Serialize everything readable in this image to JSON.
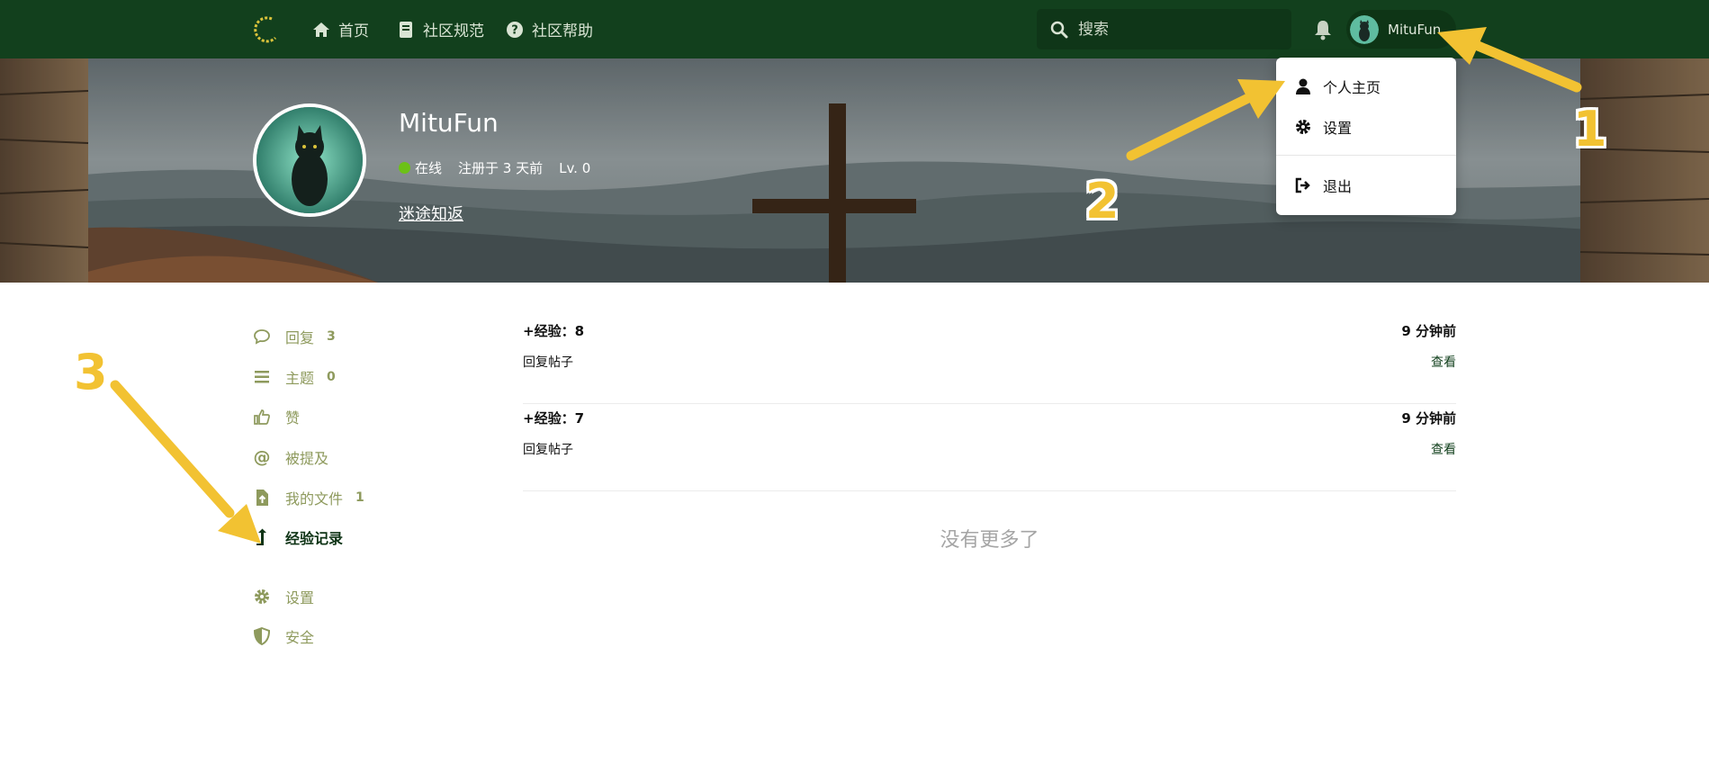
{
  "header": {
    "nav": [
      {
        "label": "首页",
        "icon": "home-icon"
      },
      {
        "label": "社区规范",
        "icon": "book-icon"
      },
      {
        "label": "社区帮助",
        "icon": "question-circle-icon"
      }
    ],
    "search_placeholder": "搜索",
    "username": "MituFun"
  },
  "profile": {
    "username": "MituFun",
    "status": "在线",
    "registered": "注册于 3 天前",
    "level": "Lv. 0",
    "bio": "迷途知返"
  },
  "dropdown": {
    "items": [
      {
        "label": "个人主页",
        "icon": "user-icon"
      },
      {
        "label": "设置",
        "icon": "gear-icon"
      },
      {
        "label": "退出",
        "icon": "sign-out-icon"
      }
    ]
  },
  "sidebar": {
    "items": [
      {
        "label": "回复",
        "count": "3",
        "icon": "comment-icon"
      },
      {
        "label": "主题",
        "count": "0",
        "icon": "bars-icon"
      },
      {
        "label": "赞",
        "count": "",
        "icon": "thumbs-up-icon"
      },
      {
        "label": "被提及",
        "count": "",
        "icon": "at-icon"
      },
      {
        "label": "我的文件",
        "count": "1",
        "icon": "file-upload-icon"
      },
      {
        "label": "经验记录",
        "count": "",
        "icon": "level-up-icon"
      },
      {
        "label": "设置",
        "count": "",
        "icon": "gear-icon"
      },
      {
        "label": "安全",
        "count": "",
        "icon": "shield-icon"
      }
    ]
  },
  "feed": {
    "rows": [
      {
        "exp": "+经验：8",
        "time": "9 分钟前",
        "desc": "回复帖子",
        "action": "查看"
      },
      {
        "exp": "+经验：7",
        "time": "9 分钟前",
        "desc": "回复帖子",
        "action": "查看"
      }
    ],
    "no_more": "没有更多了"
  },
  "annotations": [
    "1",
    "2",
    "3"
  ],
  "colors": {
    "topbar": "#12401d",
    "accent": "#f2c232",
    "sidebar_text": "#8e9a5d",
    "online": "#6cc117"
  }
}
